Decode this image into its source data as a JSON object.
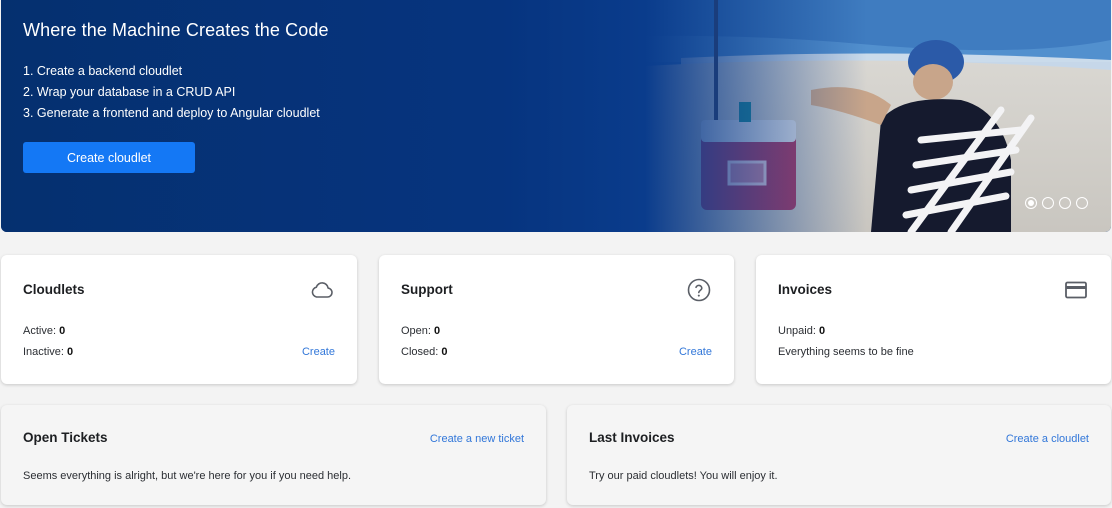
{
  "hero": {
    "title": "Where the Machine Creates the Code",
    "steps": [
      "1. Create a backend cloudlet",
      "2. Wrap your database in a CRUD API",
      "3. Generate a frontend and deploy to Angular cloudlet"
    ],
    "button_label": "Create cloudlet",
    "carousel": {
      "total": 4,
      "active_index": 0
    },
    "colors": {
      "banner": "#06347f",
      "button": "#1478f5"
    }
  },
  "cards": {
    "cloudlets": {
      "title": "Cloudlets",
      "icon": "cloud-icon",
      "active_label": "Active: ",
      "active_value": "0",
      "inactive_label": "Inactive: ",
      "inactive_value": "0",
      "link": "Create"
    },
    "support": {
      "title": "Support",
      "icon": "help-circle-icon",
      "open_label": "Open: ",
      "open_value": "0",
      "closed_label": "Closed: ",
      "closed_value": "0",
      "link": "Create"
    },
    "invoices": {
      "title": "Invoices",
      "icon": "credit-card-icon",
      "unpaid_label": "Unpaid: ",
      "unpaid_value": "0",
      "status": "Everything seems to be fine"
    }
  },
  "panels": {
    "open_tickets": {
      "title": "Open Tickets",
      "link": "Create a new ticket",
      "text": "Seems everything is alright, but we're here for you if you need help."
    },
    "last_invoices": {
      "title": "Last Invoices",
      "link": "Create a cloudlet",
      "text": "Try our paid cloudlets! You will enjoy it."
    }
  },
  "colors": {
    "link": "#3277d9",
    "page_bg": "#f3f3f3"
  }
}
